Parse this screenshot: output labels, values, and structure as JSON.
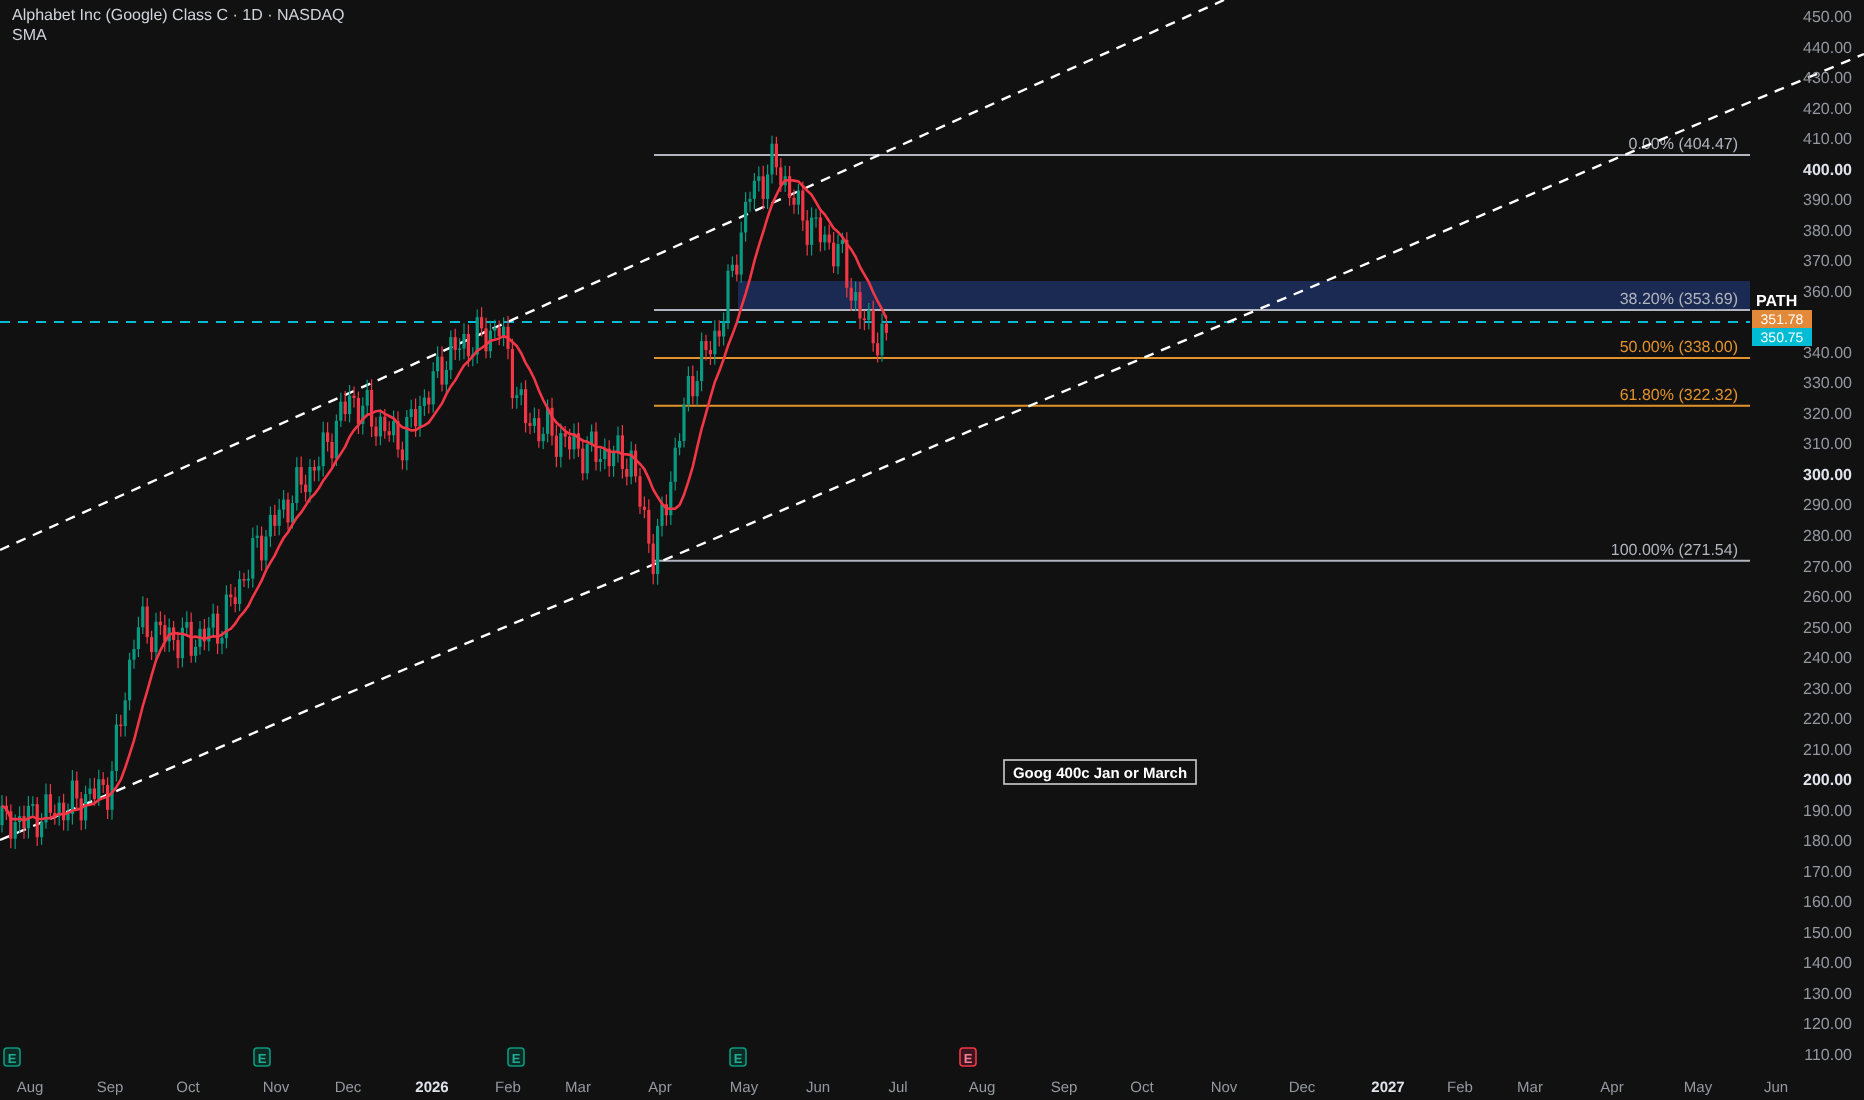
{
  "legend": {
    "title": "Alphabet Inc (Google) Class C · 1D · NASDAQ",
    "indicator": "SMA"
  },
  "price_axis": [
    {
      "label": "450.00",
      "major": false
    },
    {
      "label": "440.00",
      "major": false
    },
    {
      "label": "430.00",
      "major": false
    },
    {
      "label": "420.00",
      "major": false
    },
    {
      "label": "410.00",
      "major": false
    },
    {
      "label": "400.00",
      "major": true
    },
    {
      "label": "390.00",
      "major": false
    },
    {
      "label": "380.00",
      "major": false
    },
    {
      "label": "370.00",
      "major": false
    },
    {
      "label": "360.00",
      "major": false
    },
    {
      "label": "340.00",
      "major": false
    },
    {
      "label": "330.00",
      "major": false
    },
    {
      "label": "320.00",
      "major": false
    },
    {
      "label": "310.00",
      "major": false
    },
    {
      "label": "300.00",
      "major": true
    },
    {
      "label": "290.00",
      "major": false
    },
    {
      "label": "280.00",
      "major": false
    },
    {
      "label": "270.00",
      "major": false
    },
    {
      "label": "260.00",
      "major": false
    },
    {
      "label": "250.00",
      "major": false
    },
    {
      "label": "240.00",
      "major": false
    },
    {
      "label": "230.00",
      "major": false
    },
    {
      "label": "220.00",
      "major": false
    },
    {
      "label": "210.00",
      "major": false
    },
    {
      "label": "200.00",
      "major": true
    },
    {
      "label": "190.00",
      "major": false
    },
    {
      "label": "180.00",
      "major": false
    },
    {
      "label": "170.00",
      "major": false
    },
    {
      "label": "160.00",
      "major": false
    },
    {
      "label": "150.00",
      "major": false
    },
    {
      "label": "140.00",
      "major": false
    },
    {
      "label": "130.00",
      "major": false
    },
    {
      "label": "120.00",
      "major": false
    },
    {
      "label": "110.00",
      "major": false
    }
  ],
  "time_axis": [
    {
      "label": "Aug",
      "major": false
    },
    {
      "label": "Sep",
      "major": false
    },
    {
      "label": "Oct",
      "major": false
    },
    {
      "label": "Nov",
      "major": false
    },
    {
      "label": "Dec",
      "major": false
    },
    {
      "label": "2026",
      "major": true
    },
    {
      "label": "Feb",
      "major": false
    },
    {
      "label": "Mar",
      "major": false
    },
    {
      "label": "Apr",
      "major": false
    },
    {
      "label": "May",
      "major": false
    },
    {
      "label": "Jun",
      "major": false
    },
    {
      "label": "Jul",
      "major": false
    },
    {
      "label": "Aug",
      "major": false
    },
    {
      "label": "Sep",
      "major": false
    },
    {
      "label": "Oct",
      "major": false
    },
    {
      "label": "Nov",
      "major": false
    },
    {
      "label": "Dec",
      "major": false
    },
    {
      "label": "2027",
      "major": true
    },
    {
      "label": "Feb",
      "major": false
    },
    {
      "label": "Mar",
      "major": false
    },
    {
      "label": "Apr",
      "major": false
    },
    {
      "label": "May",
      "major": false
    },
    {
      "label": "Jun",
      "major": false
    }
  ],
  "fib_levels": [
    {
      "label": "0.00% (404.47)",
      "color": "#b2b5be"
    },
    {
      "label": "38.20% (353.69)",
      "color": "#b2b5be"
    },
    {
      "label": "50.00% (338.00)",
      "color": "#e3932b"
    },
    {
      "label": "61.80% (322.32)",
      "color": "#e3932b"
    },
    {
      "label": "100.00% (271.54)",
      "color": "#b2b5be"
    }
  ],
  "price_tags": {
    "symbol": "PATH",
    "tags": [
      {
        "label": "351.78",
        "color": "#e3893a"
      },
      {
        "label": "350.75",
        "color": "#00bcd4"
      }
    ]
  },
  "note": "Goog 400c Jan or March",
  "events": [
    {
      "label": "E",
      "kind": "past"
    },
    {
      "label": "E",
      "kind": "past"
    },
    {
      "label": "E",
      "kind": "past"
    },
    {
      "label": "E",
      "kind": "past"
    },
    {
      "label": "E",
      "kind": "upcoming"
    }
  ]
}
